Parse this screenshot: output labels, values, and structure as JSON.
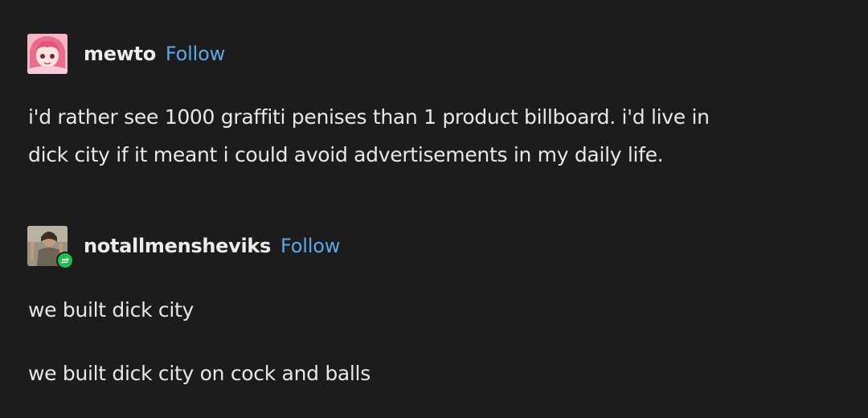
{
  "colors": {
    "background": "#1c1c1c",
    "text": "#ececec",
    "follow_link": "#5ba8e8",
    "reblog_badge": "#1fbf4f"
  },
  "posts": [
    {
      "username": "mewto",
      "follow_label": "Follow",
      "avatar_icon": "anime-avatar",
      "lines": [
        "i'd rather see 1000 graffiti penises than 1 product billboard. i'd live in",
        "dick city if it meant i could avoid advertisements in my daily life."
      ]
    },
    {
      "username": "notallmensheviks",
      "follow_label": "Follow",
      "avatar_icon": "photo-avatar",
      "badge_icon": "reblog-icon",
      "paragraphs": [
        "we built dick city",
        "we built dick city on cock and balls"
      ]
    }
  ]
}
